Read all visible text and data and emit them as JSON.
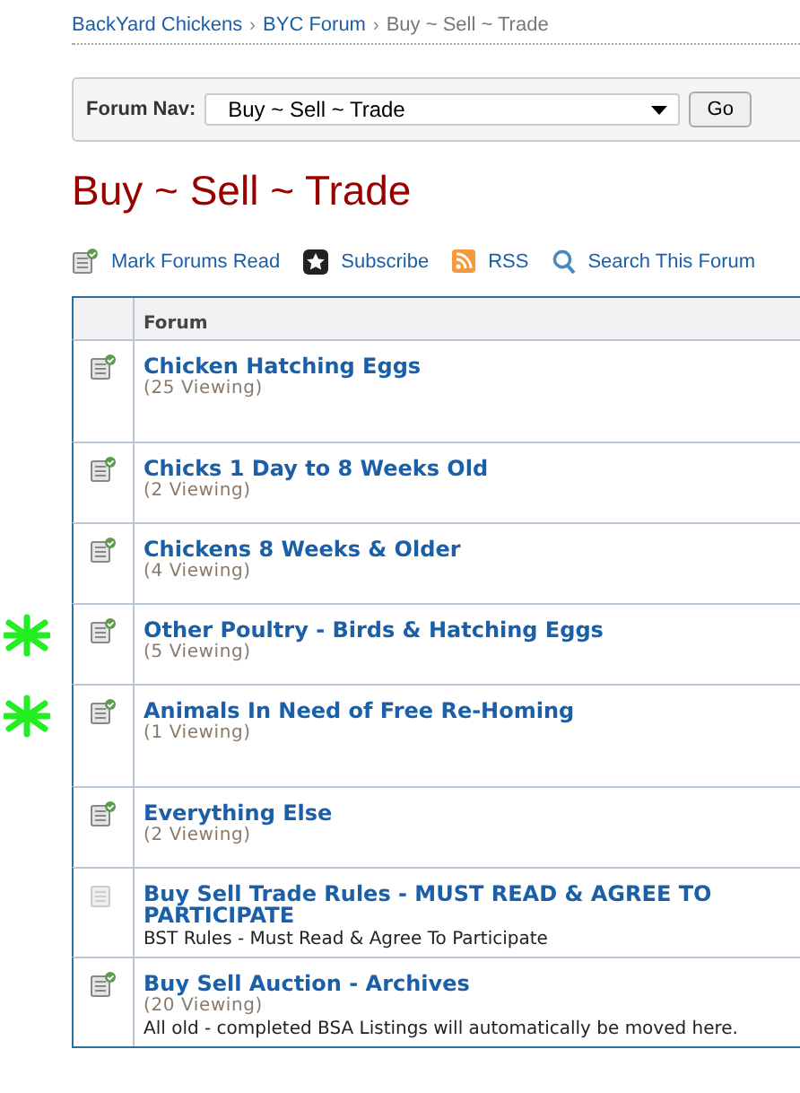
{
  "breadcrumb_separator": "›",
  "breadcrumb": [
    {
      "label": "BackYard Chickens",
      "current": false
    },
    {
      "label": "BYC Forum",
      "current": false
    },
    {
      "label": "Buy ~ Sell ~ Trade",
      "current": true
    }
  ],
  "forum_nav": {
    "label": "Forum Nav:",
    "value": "Buy ~ Sell ~ Trade",
    "button": "Go"
  },
  "title": "Buy ~ Sell ~ Trade",
  "actions": [
    {
      "kind": "mark",
      "label": "Mark Forums Read"
    },
    {
      "kind": "subscribe",
      "label": "Subscribe"
    },
    {
      "kind": "rss",
      "label": "RSS"
    },
    {
      "kind": "search",
      "label": "Search This Forum"
    }
  ],
  "table": {
    "columns": [
      "Forum"
    ],
    "forums": [
      {
        "name": "Chicken Hatching Eggs",
        "viewing": "(25 Viewing)",
        "has_new": true,
        "starred": false,
        "tall": true
      },
      {
        "name": "Chicks 1 Day to 8 Weeks Old",
        "viewing": "(2 Viewing)",
        "has_new": true,
        "starred": false,
        "tall": false
      },
      {
        "name": "Chickens 8 Weeks & Older",
        "viewing": "(4 Viewing)",
        "has_new": true,
        "starred": false,
        "tall": false
      },
      {
        "name": "Other Poultry - Birds & Hatching Eggs",
        "viewing": "(5 Viewing)",
        "has_new": true,
        "starred": true,
        "tall": false
      },
      {
        "name": "Animals In Need of Free Re-Homing",
        "viewing": "(1 Viewing)",
        "has_new": true,
        "starred": true,
        "tall": true
      },
      {
        "name": "Everything Else",
        "viewing": "(2 Viewing)",
        "has_new": true,
        "starred": false,
        "tall": false
      },
      {
        "name": "Buy Sell Trade Rules - MUST READ & AGREE TO PARTICIPATE",
        "description": "BST Rules - Must Read & Agree To Participate",
        "has_new": false,
        "starred": false,
        "tall": false
      },
      {
        "name": "Buy Sell Auction - Archives",
        "viewing": "(20 Viewing)",
        "description": "All old - completed BSA Listings will automatically be moved here.",
        "has_new": true,
        "starred": false,
        "tall": false
      }
    ]
  }
}
